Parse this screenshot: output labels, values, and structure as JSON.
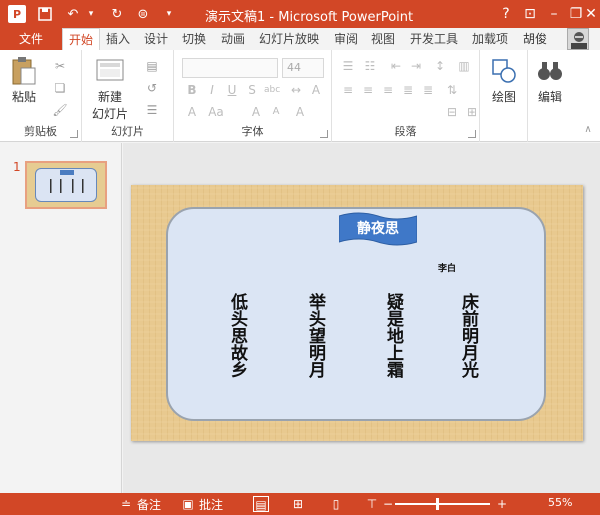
{
  "window": {
    "title": "演示文稿1 - Microsoft PowerPoint",
    "app_icon": "P",
    "user_name": "胡俊"
  },
  "tabs": {
    "file": "文件",
    "items": [
      "开始",
      "插入",
      "设计",
      "切换",
      "动画",
      "幻灯片放映",
      "审阅",
      "视图",
      "开发工具",
      "加载项"
    ]
  },
  "ribbon": {
    "groups": {
      "clipboard": "剪贴板",
      "slides": "幻灯片",
      "font": "字体",
      "paragraph": "段落"
    },
    "paste_label": "粘贴",
    "new_slide_label_1": "新建",
    "new_slide_label_2": "幻灯片",
    "font_size": "44",
    "drawing_label": "绘图",
    "editing_label": "编辑"
  },
  "thumbnails": {
    "slide_number": "1"
  },
  "slide": {
    "banner_title": "静夜思",
    "author": "李白",
    "columns": [
      "床前明月光",
      "疑是地上霜",
      "举头望明月",
      "低头思故乡"
    ]
  },
  "statusbar": {
    "notes": "备注",
    "comments": "批注",
    "zoom": "55%"
  }
}
